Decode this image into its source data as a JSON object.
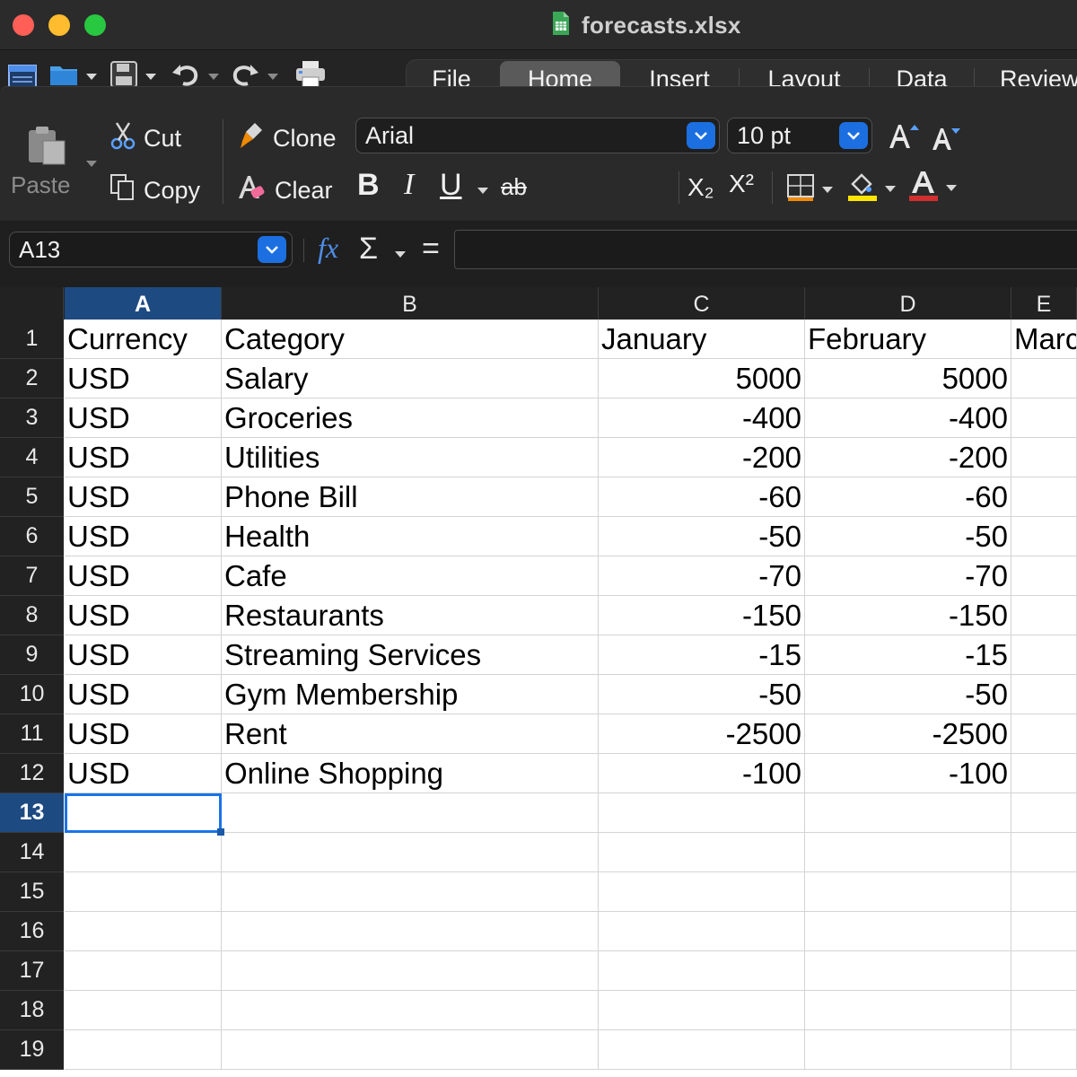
{
  "window": {
    "title": "forecasts.xlsx"
  },
  "quick_toolbar": {
    "icons": [
      "new-sheet-icon",
      "open-folder-icon",
      "save-icon",
      "undo-icon",
      "redo-icon",
      "print-icon"
    ]
  },
  "tabs": [
    {
      "label": "File",
      "active": false
    },
    {
      "label": "Home",
      "active": true
    },
    {
      "label": "Insert",
      "active": false
    },
    {
      "label": "Layout",
      "active": false
    },
    {
      "label": "Data",
      "active": false
    },
    {
      "label": "Review",
      "active": false
    }
  ],
  "ribbon": {
    "paste_label": "Paste",
    "cut_label": "Cut",
    "copy_label": "Copy",
    "clone_label": "Clone",
    "clear_label": "Clear",
    "font_name": "Arial",
    "font_size": "10 pt",
    "bold_glyph": "B",
    "italic_glyph": "I",
    "underline_glyph": "U",
    "strike_glyph": "ab",
    "subscript_glyph": "X₂",
    "superscript_glyph": "X²",
    "fill_color": "#ffe600",
    "font_color": "#d32f2f",
    "border_accent": "#f08a00"
  },
  "formula_bar": {
    "cell_ref": "A13",
    "fx_glyph": "fx",
    "sigma_glyph": "Σ",
    "equals_glyph": "=",
    "value": ""
  },
  "sheet": {
    "columns": [
      "A",
      "B",
      "C",
      "D",
      "E"
    ],
    "active_column": "A",
    "active_row": 13,
    "row_numbers": [
      "1",
      "2",
      "3",
      "4",
      "5",
      "6",
      "7",
      "8",
      "9",
      "10",
      "11",
      "12",
      "13",
      "14",
      "15",
      "16",
      "17",
      "18",
      "19"
    ],
    "header": [
      "Currency",
      "Category",
      "January",
      "February",
      "Marc"
    ],
    "rows": [
      [
        "USD",
        "Salary",
        "5000",
        "5000"
      ],
      [
        "USD",
        "Groceries",
        "-400",
        "-400"
      ],
      [
        "USD",
        "Utilities",
        "-200",
        "-200"
      ],
      [
        "USD",
        "Phone Bill",
        "-60",
        "-60"
      ],
      [
        "USD",
        "Health",
        "-50",
        "-50"
      ],
      [
        "USD",
        "Cafe",
        "-70",
        "-70"
      ],
      [
        "USD",
        "Restaurants",
        "-150",
        "-150"
      ],
      [
        "USD",
        "Streaming Services",
        "-15",
        "-15"
      ],
      [
        "USD",
        "Gym Membership",
        "-50",
        "-50"
      ],
      [
        "USD",
        "Rent",
        "-2500",
        "-2500"
      ],
      [
        "USD",
        "Online Shopping",
        "-100",
        "-100"
      ]
    ]
  }
}
